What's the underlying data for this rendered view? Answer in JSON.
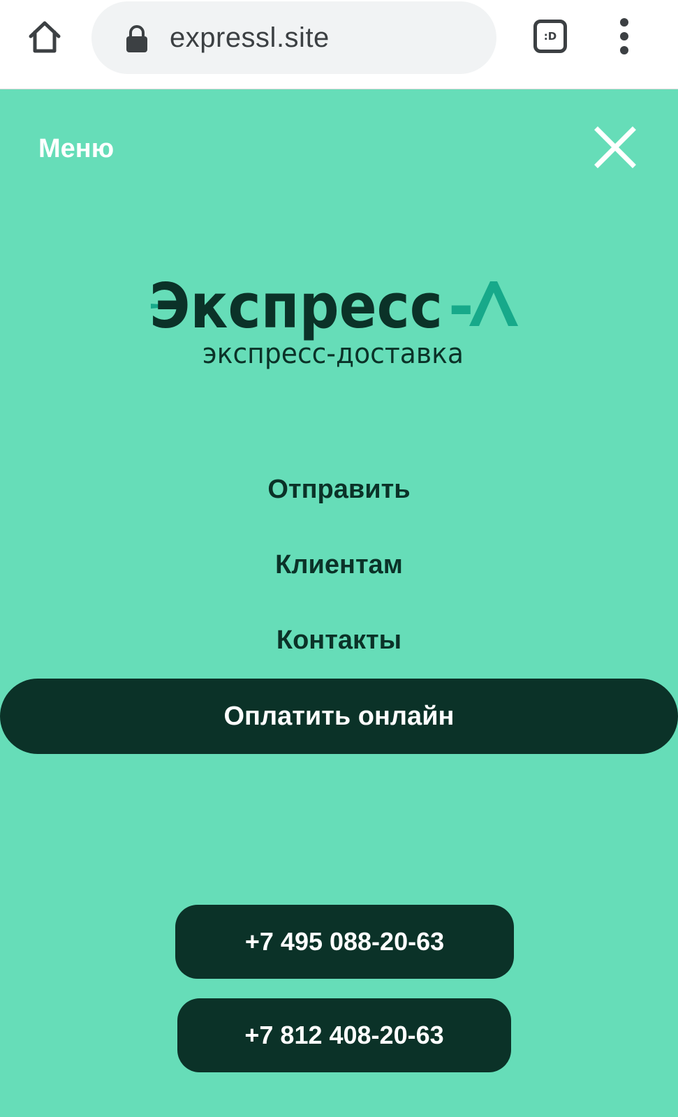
{
  "browser": {
    "url": "expressl.site",
    "tab_switcher_label": ":D",
    "icons": {
      "home": "home-icon",
      "lock": "lock-icon",
      "menu": "more-vertical-icon"
    }
  },
  "menu": {
    "title": "Меню",
    "close_icon": "close-icon"
  },
  "logo": {
    "name": "Экспресс-Л",
    "tagline": "экспресс-доставка",
    "dark_color": "#0b3228",
    "accent_color": "#17a98a"
  },
  "nav": {
    "items": [
      {
        "label": "Отправить"
      },
      {
        "label": "Клиентам"
      },
      {
        "label": "Контакты"
      }
    ]
  },
  "actions": {
    "pay_label": "Оплатить онлайн"
  },
  "phones": [
    {
      "number": "+7 495 088-20-63"
    },
    {
      "number": "+7 812 408-20-63"
    }
  ],
  "colors": {
    "background": "#66ddb8",
    "button": "#0b3228",
    "button_text": "#ffffff"
  }
}
